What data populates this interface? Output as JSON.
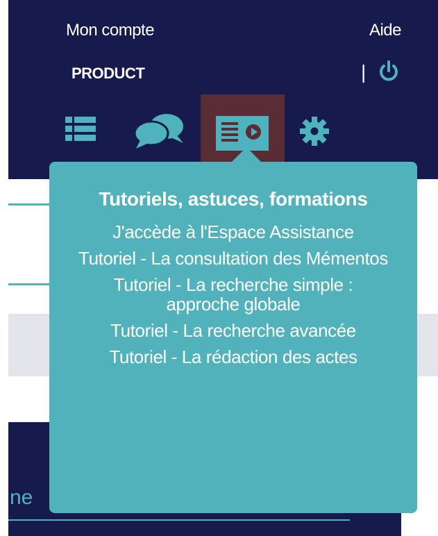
{
  "header": {
    "account_label": "Mon compte",
    "help_label": "Aide",
    "product_label": "PRODUCT",
    "separator": "|",
    "icons": {
      "power": "power-icon",
      "list": "list-icon",
      "chat": "chat-bubbles-icon",
      "tutorial": "video-tutorial-icon",
      "settings": "gear-icon"
    }
  },
  "popover": {
    "title": "Tutoriels, astuces, formations",
    "items": [
      "J'accède à l'Espace Assistance",
      "Tutoriel - La consultation des Mémentos",
      "Tutoriel - La recherche simple : approche globale",
      "Tutoriel - La recherche avancée",
      "Tutoriel - La rédaction des actes"
    ]
  },
  "main": {
    "partial_text": "ne"
  },
  "colors": {
    "navy": "#161a4d",
    "teal": "#51b2bb",
    "active_icon_bg": "#5a2d36",
    "band": "#e4e5ea"
  }
}
